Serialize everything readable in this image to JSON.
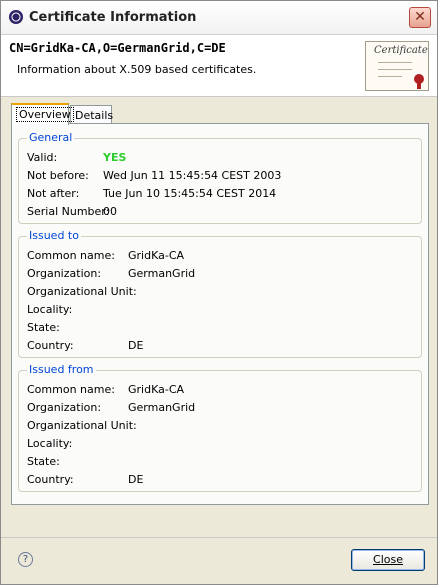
{
  "window": {
    "title": "Certificate Information"
  },
  "header": {
    "cn": "CN=GridKa-CA,O=GermanGrid,C=DE",
    "description": "Information about X.509 based certificates.",
    "image_icon": "certificate-icon"
  },
  "tabs": [
    {
      "label": "Overview",
      "active": true
    },
    {
      "label": "Details",
      "active": false
    }
  ],
  "general": {
    "title": "General",
    "valid_label": "Valid:",
    "valid_value": "YES",
    "not_before_label": "Not before:",
    "not_before_value": "Wed Jun 11 15:45:54 CEST 2003",
    "not_after_label": "Not after:",
    "not_after_value": "Tue Jun 10 15:45:54 CEST 2014",
    "serial_label": "Serial Number:",
    "serial_value": "00"
  },
  "issued_to": {
    "title": "Issued to",
    "rows": [
      {
        "label": "Common name:",
        "value": "GridKa-CA"
      },
      {
        "label": "Organization:",
        "value": "GermanGrid"
      },
      {
        "label": "Organizational Unit:",
        "value": ""
      },
      {
        "label": "Locality:",
        "value": ""
      },
      {
        "label": "State:",
        "value": ""
      },
      {
        "label": "Country:",
        "value": "DE"
      }
    ]
  },
  "issued_from": {
    "title": "Issued from",
    "rows": [
      {
        "label": "Common name:",
        "value": "GridKa-CA"
      },
      {
        "label": "Organization:",
        "value": "GermanGrid"
      },
      {
        "label": "Organizational Unit:",
        "value": ""
      },
      {
        "label": "Locality:",
        "value": ""
      },
      {
        "label": "State:",
        "value": ""
      },
      {
        "label": "Country:",
        "value": "DE"
      }
    ]
  },
  "buttons": {
    "close_label": "Close",
    "help_icon": "help-icon"
  },
  "colors": {
    "valid_yes": "#2ecc2e",
    "group_title": "#0046d5"
  }
}
